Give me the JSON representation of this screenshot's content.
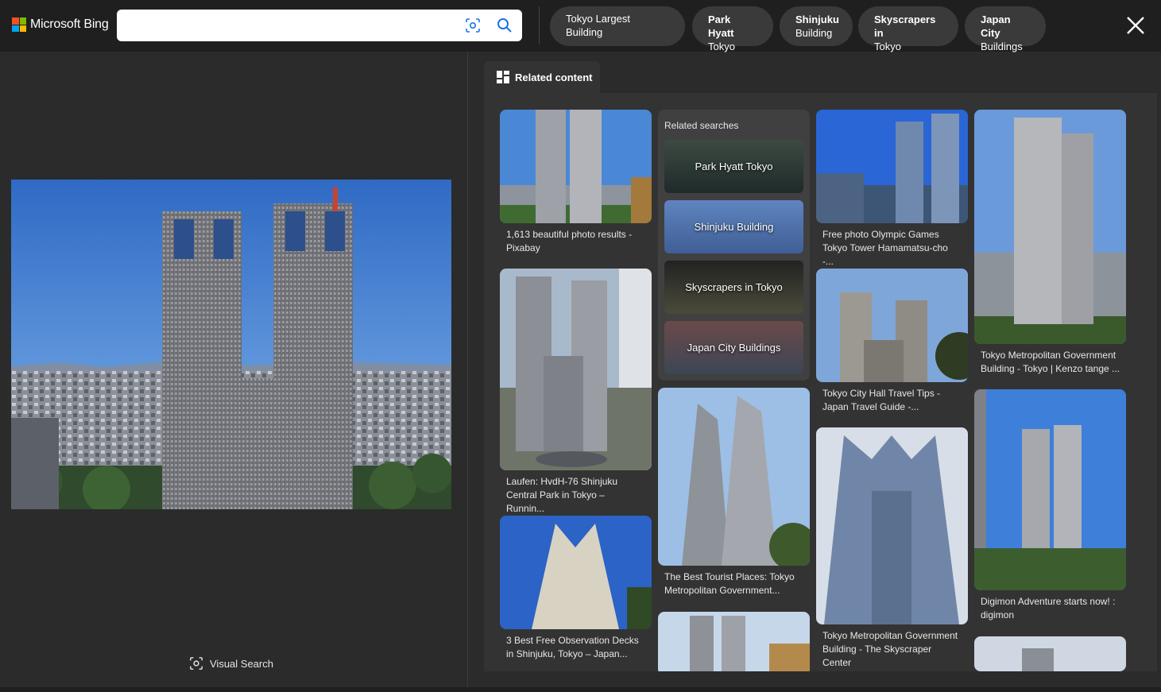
{
  "header": {
    "brand": "Microsoft Bing",
    "search_value": "",
    "pills": [
      {
        "l1": "Tokyo Largest Building",
        "l2": ""
      },
      {
        "l1": "Park Hyatt",
        "l2": "Tokyo"
      },
      {
        "l1": "Shinjuku",
        "l2": "Building"
      },
      {
        "l1": "Skyscrapers in",
        "l2": "Tokyo"
      },
      {
        "l1": "Japan City",
        "l2": "Buildings"
      }
    ]
  },
  "left": {
    "visual_search_label": "Visual Search"
  },
  "tab": {
    "label": "Related content"
  },
  "related_searches": {
    "title": "Related searches",
    "items": [
      "Park Hyatt Tokyo",
      "Shinjuku Building",
      "Skyscrapers in Tokyo",
      "Japan City Buildings"
    ]
  },
  "cards": {
    "c1": "1,613 beautiful photo results - Pixabay",
    "c2": "Laufen: HvdH-76 Shinjuku Central Park in Tokyo – Runnin...",
    "c3": "3 Best Free Observation Decks in Shinjuku, Tokyo – Japan...",
    "c4": "The Best Tourist Places: Tokyo Metropolitan Government...",
    "c5": "Free photo Olympic Games Tokyo Tower Hamamatsu-cho -...",
    "c6": "Tokyo City Hall Travel Tips - Japan Travel Guide -...",
    "c7": "Tokyo Metropolitan Government Building - The Skyscraper Center",
    "c8": "Tokyo Metropolitan Government Building - Tokyo | Kenzo tange ...",
    "c9": "Digimon Adventure starts now! : digimon"
  },
  "colors": {
    "accent_bg": "#1f1f1f",
    "panel": "#333333",
    "sky": "#3b74c9"
  }
}
